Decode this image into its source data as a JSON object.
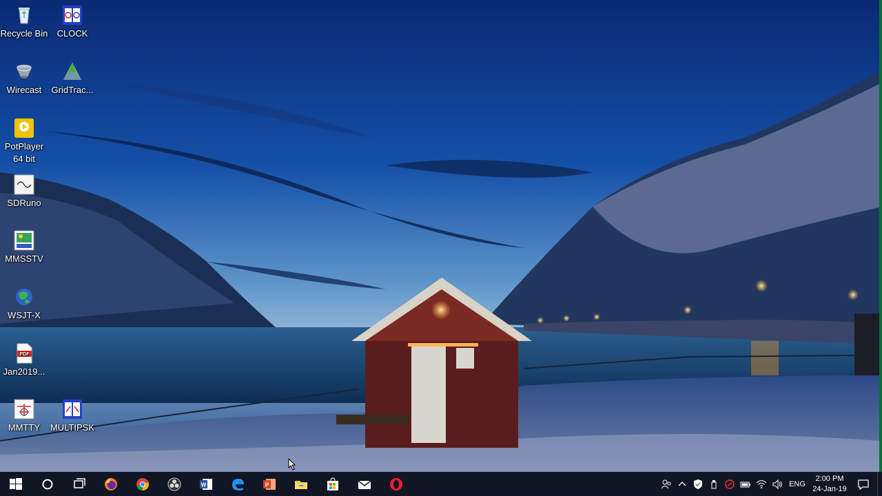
{
  "desktop": {
    "icons": [
      {
        "label": "Recycle Bin",
        "icon": "recycle-bin-icon"
      },
      {
        "label": "CLOCK",
        "icon": "clock-app-icon"
      },
      {
        "label": "Wirecast",
        "icon": "wirecast-icon"
      },
      {
        "label": "GridTrac...",
        "icon": "gridtracker-icon"
      },
      {
        "label": "PotPlayer 64 bit",
        "icon": "potplayer-icon"
      },
      {
        "label": "SDRuno",
        "icon": "sdruno-icon"
      },
      {
        "label": "MMSSTV",
        "icon": "mmsstv-icon"
      },
      {
        "label": "WSJT-X",
        "icon": "wsjtx-icon"
      },
      {
        "label": "Jan2019...",
        "icon": "pdf-file-icon"
      },
      {
        "label": "MMTTY",
        "icon": "mmtty-icon"
      },
      {
        "label": "MULTIPSK",
        "icon": "multipsk-icon"
      }
    ]
  },
  "taskbar": {
    "pinned": [
      {
        "name": "start",
        "icon": "windows-start-icon"
      },
      {
        "name": "search",
        "icon": "cortana-search-icon"
      },
      {
        "name": "task-view",
        "icon": "task-view-icon"
      },
      {
        "name": "firefox",
        "icon": "firefox-icon"
      },
      {
        "name": "chrome",
        "icon": "chrome-icon"
      },
      {
        "name": "obs",
        "icon": "obs-icon"
      },
      {
        "name": "word",
        "icon": "word-icon"
      },
      {
        "name": "edge",
        "icon": "edge-icon"
      },
      {
        "name": "powerpoint",
        "icon": "powerpoint-icon"
      },
      {
        "name": "file-explorer",
        "icon": "file-explorer-icon"
      },
      {
        "name": "store",
        "icon": "store-icon"
      },
      {
        "name": "mail",
        "icon": "mail-icon"
      },
      {
        "name": "opera",
        "icon": "opera-icon"
      }
    ],
    "tray": {
      "language": "ENG",
      "time": "2:00 PM",
      "date": "24-Jan-19"
    }
  },
  "colors": {
    "taskbar_bg": "#101624",
    "accent_green": "#0f6b3a"
  }
}
